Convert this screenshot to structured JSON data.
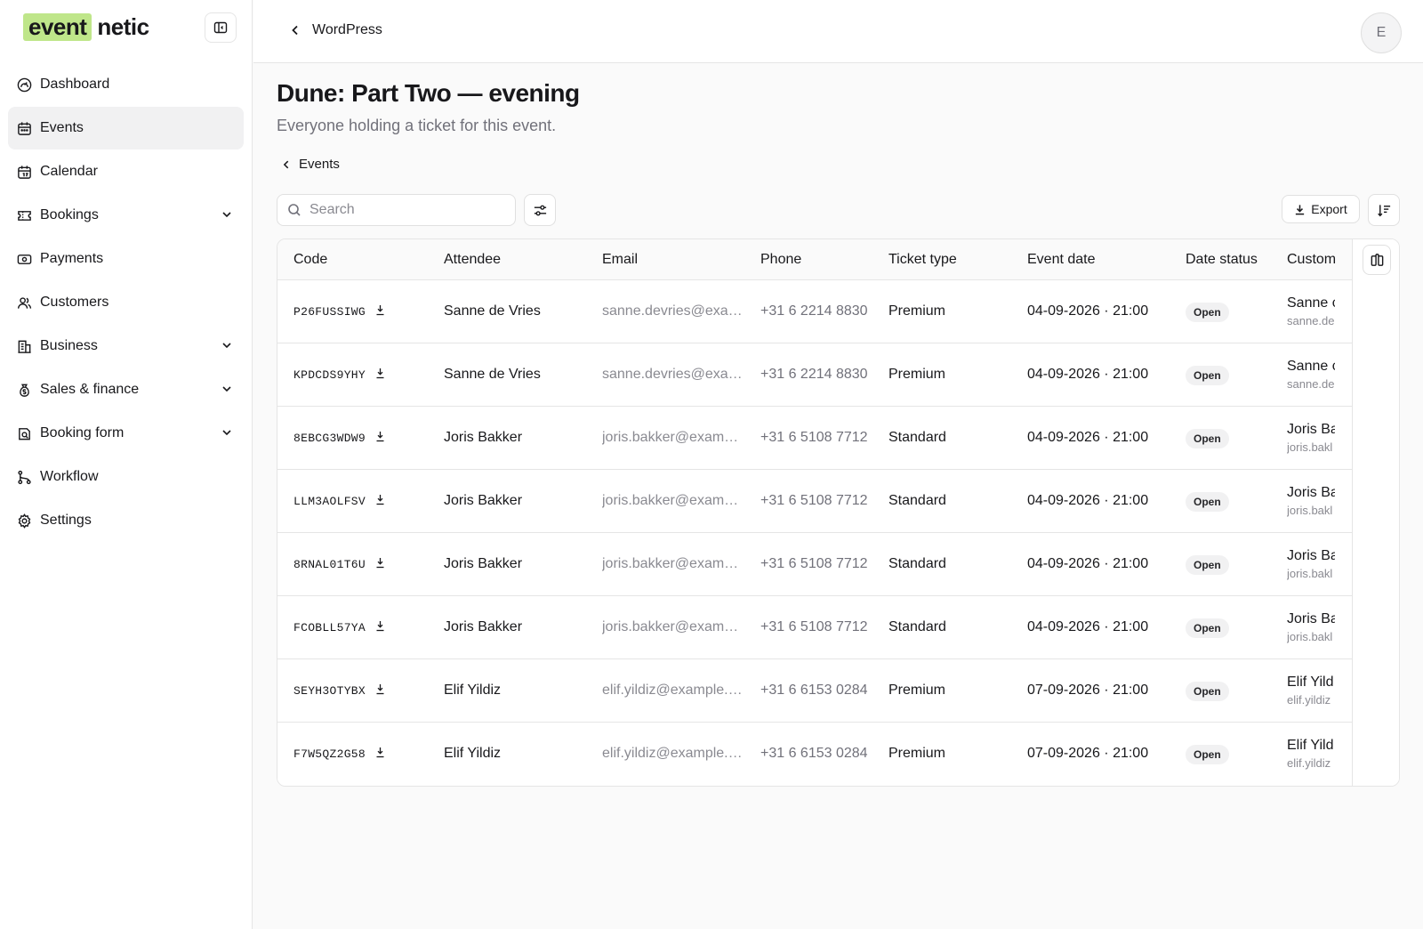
{
  "brand": {
    "part1": "event",
    "part2": "netic",
    "accent": "#bfe68a"
  },
  "sidebar": {
    "items": [
      {
        "label": "Dashboard",
        "icon": "dashboard-icon"
      },
      {
        "label": "Events",
        "icon": "calendar-icon",
        "active": true
      },
      {
        "label": "Calendar",
        "icon": "calendar-days-icon"
      },
      {
        "label": "Bookings",
        "icon": "ticket-icon",
        "expandable": true
      },
      {
        "label": "Payments",
        "icon": "banknote-icon"
      },
      {
        "label": "Customers",
        "icon": "users-icon"
      },
      {
        "label": "Business",
        "icon": "building-icon",
        "expandable": true
      },
      {
        "label": "Sales & finance",
        "icon": "money-bag-icon",
        "expandable": true
      },
      {
        "label": "Booking form",
        "icon": "form-icon",
        "expandable": true
      },
      {
        "label": "Workflow",
        "icon": "workflow-icon"
      },
      {
        "label": "Settings",
        "icon": "gear-icon"
      }
    ]
  },
  "topbar": {
    "back_label": "WordPress",
    "avatar_initial": "E"
  },
  "page": {
    "title": "Dune: Part Two — evening",
    "subtitle": "Everyone holding a ticket for this event.",
    "breadcrumb": "Events"
  },
  "toolbar": {
    "search_placeholder": "Search",
    "export_label": "Export"
  },
  "table": {
    "columns": [
      "Code",
      "Attendee",
      "Email",
      "Phone",
      "Ticket type",
      "Event date",
      "Date status",
      "Custom"
    ],
    "rows": [
      {
        "code": "P26FUSSIWG",
        "attendee": "Sanne de Vries",
        "email": "sanne.devries@exam...",
        "phone": "+31 6 2214 8830",
        "ticket": "Premium",
        "date": "04-09-2026 · 21:00",
        "status": "Open",
        "cust_name": "Sanne c",
        "cust_mail": "sanne.de"
      },
      {
        "code": "KPDCDS9YHY",
        "attendee": "Sanne de Vries",
        "email": "sanne.devries@exam...",
        "phone": "+31 6 2214 8830",
        "ticket": "Premium",
        "date": "04-09-2026 · 21:00",
        "status": "Open",
        "cust_name": "Sanne c",
        "cust_mail": "sanne.de"
      },
      {
        "code": "8EBCG3WDW9",
        "attendee": "Joris Bakker",
        "email": "joris.bakker@exampl...",
        "phone": "+31 6 5108 7712",
        "ticket": "Standard",
        "date": "04-09-2026 · 21:00",
        "status": "Open",
        "cust_name": "Joris Ba",
        "cust_mail": "joris.bakl"
      },
      {
        "code": "LLM3AOLFSV",
        "attendee": "Joris Bakker",
        "email": "joris.bakker@exampl...",
        "phone": "+31 6 5108 7712",
        "ticket": "Standard",
        "date": "04-09-2026 · 21:00",
        "status": "Open",
        "cust_name": "Joris Ba",
        "cust_mail": "joris.bakl"
      },
      {
        "code": "8RNAL01T6U",
        "attendee": "Joris Bakker",
        "email": "joris.bakker@exampl...",
        "phone": "+31 6 5108 7712",
        "ticket": "Standard",
        "date": "04-09-2026 · 21:00",
        "status": "Open",
        "cust_name": "Joris Ba",
        "cust_mail": "joris.bakl"
      },
      {
        "code": "FCOBLL57YA",
        "attendee": "Joris Bakker",
        "email": "joris.bakker@exampl...",
        "phone": "+31 6 5108 7712",
        "ticket": "Standard",
        "date": "04-09-2026 · 21:00",
        "status": "Open",
        "cust_name": "Joris Ba",
        "cust_mail": "joris.bakl"
      },
      {
        "code": "SEYH3OTYBX",
        "attendee": "Elif Yildiz",
        "email": "elif.yildiz@example.c...",
        "phone": "+31 6 6153 0284",
        "ticket": "Premium",
        "date": "07-09-2026 · 21:00",
        "status": "Open",
        "cust_name": "Elif Yild",
        "cust_mail": "elif.yildiz"
      },
      {
        "code": "F7W5QZ2G58",
        "attendee": "Elif Yildiz",
        "email": "elif.yildiz@example.c...",
        "phone": "+31 6 6153 0284",
        "ticket": "Premium",
        "date": "07-09-2026 · 21:00",
        "status": "Open",
        "cust_name": "Elif Yild",
        "cust_mail": "elif.yildiz"
      }
    ]
  }
}
